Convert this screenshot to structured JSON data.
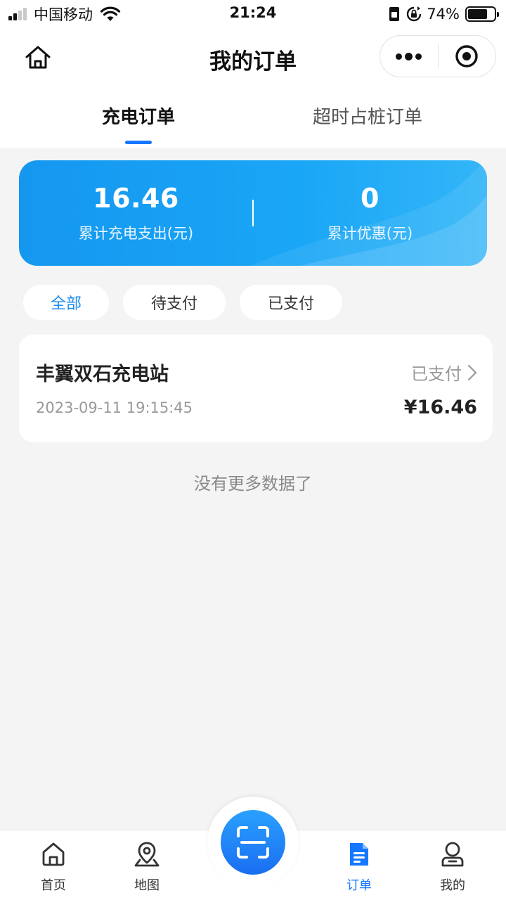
{
  "status_bar": {
    "carrier": "中国移动",
    "time": "21:24",
    "battery": "74%",
    "battery_level": 0.74
  },
  "nav": {
    "title": "我的订单",
    "icons": {
      "home": "home-icon",
      "more": "more-dots-icon",
      "close": "miniapp-close-icon"
    }
  },
  "tabs": [
    {
      "label": "充电订单",
      "active": true
    },
    {
      "label": "超时占桩订单",
      "active": false
    }
  ],
  "summary": {
    "total_spend": {
      "value": "16.46",
      "label": "累计充电支出(元)"
    },
    "total_discount": {
      "value": "0",
      "label": "累计优惠(元)"
    }
  },
  "filters": [
    {
      "label": "全部",
      "active": true
    },
    {
      "label": "待支付",
      "active": false
    },
    {
      "label": "已支付",
      "active": false
    }
  ],
  "orders": [
    {
      "station": "丰翼双石充电站",
      "status": "已支付",
      "time": "2023-09-11 19:15:45",
      "amount": "¥16.46"
    }
  ],
  "list_end_text": "没有更多数据了",
  "bottom_nav": [
    {
      "label": "首页",
      "icon": "home-icon",
      "active": false
    },
    {
      "label": "地图",
      "icon": "map-pin-icon",
      "active": false
    },
    {
      "label": "订单",
      "icon": "order-document-icon",
      "active": true
    },
    {
      "label": "我的",
      "icon": "user-icon",
      "active": false
    }
  ],
  "scan_button": {
    "icon": "scan-icon"
  },
  "colors": {
    "accent": "#1677ff",
    "card_gradient_start": "#1597f0",
    "card_gradient_end": "#33b6f8",
    "page_bg": "#f4f4f4"
  }
}
